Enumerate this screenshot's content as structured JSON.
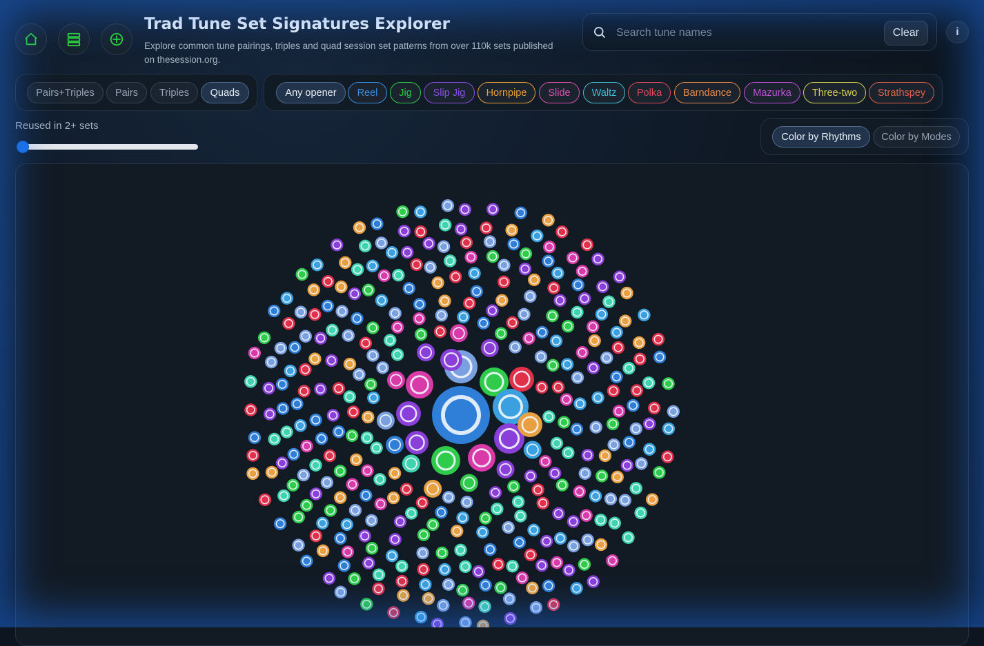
{
  "header": {
    "title": "Trad Tune Set Signatures Explorer",
    "subtitle": "Explore common tune pairings, triples and quad session set patterns from over 110k sets published on thesession.org.",
    "nav_icons": [
      "home-icon",
      "database-icon",
      "crosshair-icon"
    ],
    "accent_color": "#2fd33a"
  },
  "search": {
    "placeholder": "Search tune names",
    "value": "",
    "clear_label": "Clear"
  },
  "info_label": "i",
  "set_types": {
    "items": [
      "Pairs+Triples",
      "Pairs",
      "Triples",
      "Quads"
    ],
    "selected": "Quads"
  },
  "openers": {
    "items": [
      {
        "label": "Any opener",
        "color": "#e9f0f7"
      },
      {
        "label": "Reel",
        "color": "#3b8fe0"
      },
      {
        "label": "Jig",
        "color": "#2ecc4a"
      },
      {
        "label": "Slip Jig",
        "color": "#8a4fe0"
      },
      {
        "label": "Hornpipe",
        "color": "#e8a03a"
      },
      {
        "label": "Slide",
        "color": "#e050b0"
      },
      {
        "label": "Waltz",
        "color": "#40c0d8"
      },
      {
        "label": "Polka",
        "color": "#e04a5a"
      },
      {
        "label": "Barndance",
        "color": "#e88a4a"
      },
      {
        "label": "Mazurka",
        "color": "#c050d8"
      },
      {
        "label": "Three-two",
        "color": "#d8d050"
      },
      {
        "label": "Strathspey",
        "color": "#e0604a"
      }
    ],
    "selected": "Any opener"
  },
  "slider": {
    "label": "Reused in 2+ sets",
    "value": 2
  },
  "color_mode": {
    "items": [
      "Color by Rhythms",
      "Color by Modes"
    ],
    "selected": "Color by Rhythms"
  },
  "chart_data": {
    "type": "bubble-pack",
    "color_palette": [
      "#2f7ed8",
      "#3aa0e0",
      "#2ecc4a",
      "#3fd3b0",
      "#d83aa8",
      "#e0304a",
      "#8a3fd8",
      "#e8a040",
      "#7aa0e0"
    ]
  }
}
